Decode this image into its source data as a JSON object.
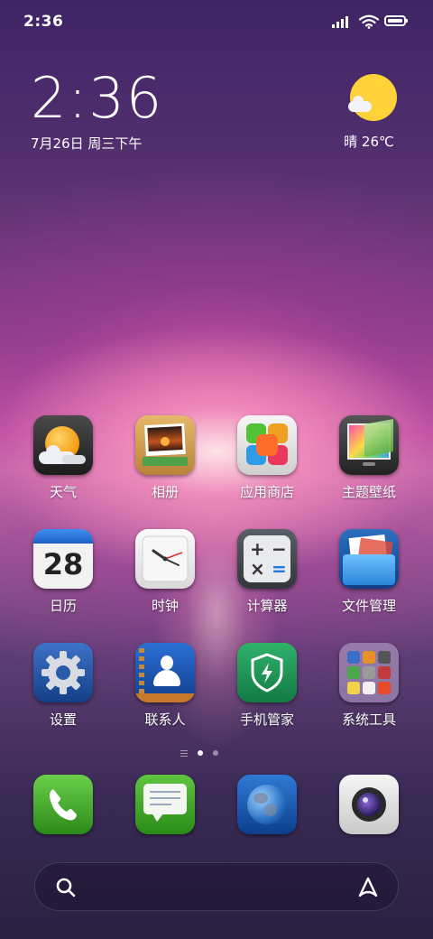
{
  "status_bar": {
    "time": "2:36",
    "icons": [
      "signal-icon",
      "wifi-icon",
      "battery-icon"
    ]
  },
  "clock_widget": {
    "time": "2:36",
    "date": "7月26日 周三下午"
  },
  "weather_widget": {
    "icon": "sunny-cloud-icon",
    "text": "晴 26℃"
  },
  "apps": [
    {
      "label": "天气",
      "icon": "weather-icon"
    },
    {
      "label": "相册",
      "icon": "gallery-icon"
    },
    {
      "label": "应用商店",
      "icon": "app-store-icon"
    },
    {
      "label": "主题壁纸",
      "icon": "themes-icon"
    },
    {
      "label": "日历",
      "icon": "calendar-icon",
      "icon_text": "28"
    },
    {
      "label": "时钟",
      "icon": "clock-icon"
    },
    {
      "label": "计算器",
      "icon": "calculator-icon"
    },
    {
      "label": "文件管理",
      "icon": "file-manager-icon"
    },
    {
      "label": "设置",
      "icon": "settings-icon"
    },
    {
      "label": "联系人",
      "icon": "contacts-icon"
    },
    {
      "label": "手机管家",
      "icon": "security-icon"
    },
    {
      "label": "系统工具",
      "icon": "system-tools-folder-icon"
    }
  ],
  "page_indicator": {
    "pages": 2,
    "current": 1
  },
  "dock": [
    {
      "name": "phone",
      "icon": "phone-icon"
    },
    {
      "name": "messages",
      "icon": "messages-icon"
    },
    {
      "name": "browser",
      "icon": "browser-icon"
    },
    {
      "name": "camera",
      "icon": "camera-icon"
    }
  ],
  "search_bar": {
    "left_icon": "search-icon",
    "right_icon": "assistant-icon"
  },
  "colors": {
    "sun": "#ffd23a",
    "text": "#ffffff"
  }
}
